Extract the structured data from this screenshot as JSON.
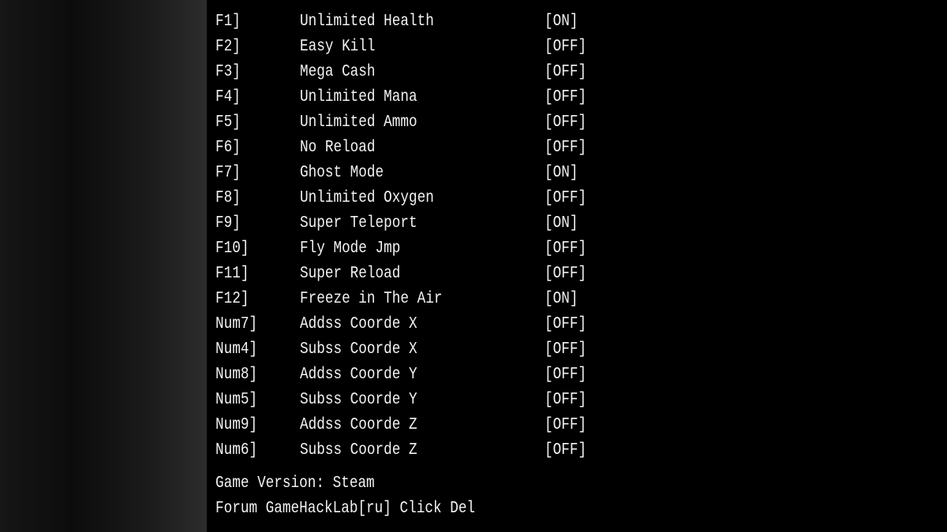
{
  "cheats": [
    {
      "key": "F1]",
      "name": "Unlimited Health",
      "status": "[ON]"
    },
    {
      "key": "F2]",
      "name": "Easy Kill",
      "status": "[OFF]"
    },
    {
      "key": "F3]",
      "name": "Mega Cash",
      "status": "[OFF]"
    },
    {
      "key": "F4]",
      "name": "Unlimited Mana",
      "status": "[OFF]"
    },
    {
      "key": "F5]",
      "name": "Unlimited Ammo",
      "status": "[OFF]"
    },
    {
      "key": "F6]",
      "name": "No Reload",
      "status": "[OFF]"
    },
    {
      "key": "F7]",
      "name": "Ghost Mode",
      "status": "[ON]"
    },
    {
      "key": "F8]",
      "name": "Unlimited Oxygen",
      "status": "[OFF]"
    },
    {
      "key": "F9]",
      "name": "Super Teleport",
      "status": "[ON]"
    },
    {
      "key": "F10]",
      "name": "Fly Mode Jmp",
      "status": "[OFF]"
    },
    {
      "key": "F11]",
      "name": "Super Reload",
      "status": "[OFF]"
    },
    {
      "key": "F12]",
      "name": "Freeze in The Air",
      "status": "[ON]"
    },
    {
      "key": "Num7]",
      "name": "Addss Coorde X",
      "status": "[OFF]"
    },
    {
      "key": "Num4]",
      "name": "Subss Coorde X",
      "status": "[OFF]"
    },
    {
      "key": "Num8]",
      "name": "Addss Coorde Y",
      "status": "[OFF]"
    },
    {
      "key": "Num5]",
      "name": "Subss Coorde Y",
      "status": "[OFF]"
    },
    {
      "key": "Num9]",
      "name": "Addss Coorde Z",
      "status": "[OFF]"
    },
    {
      "key": "Num6]",
      "name": "Subss Coorde Z",
      "status": "[OFF]"
    }
  ],
  "footer": {
    "version": "Game Version: Steam",
    "forum": "Forum GameHackLab[ru] Click Del"
  }
}
